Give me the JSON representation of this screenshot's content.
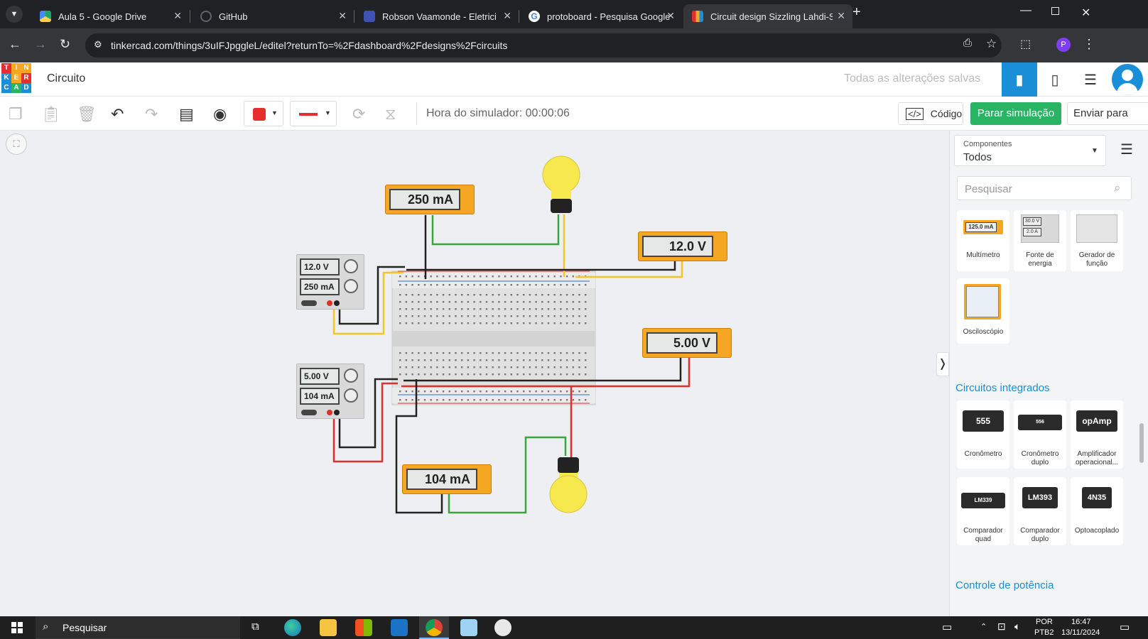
{
  "browser": {
    "tabs": [
      {
        "title": "Aula 5 - Google Drive",
        "icon": "google-drive-icon"
      },
      {
        "title": "GitHub",
        "icon": "github-icon"
      },
      {
        "title": "Robson Vaamonde - Eletricidad",
        "icon": "doc-icon"
      },
      {
        "title": "protoboard - Pesquisa Google",
        "icon": "google-icon"
      },
      {
        "title": "Circuit design Sizzling Lahdi-Sa",
        "icon": "tinkercad-icon"
      }
    ],
    "url": "tinkercad.com/things/3uIFJpggleL/editel?returnTo=%2Fdashboard%2Fdesigns%2Fcircuits",
    "profile_initial": "P"
  },
  "app": {
    "logo_letters": [
      "T",
      "I",
      "N",
      "K",
      "E",
      "R",
      "C",
      "A",
      "D"
    ],
    "title": "Circuito",
    "save_status": "Todas as alterações salvas"
  },
  "toolbar": {
    "simulator_time": "Hora do simulador: 00:00:06",
    "code_label": "Código",
    "stop_sim_label": "Parar simulação",
    "send_label": "Enviar para"
  },
  "colors": {
    "accent": "#1a8fd8",
    "stop_sim": "#28b463",
    "fill_color": "#e62e2e",
    "wire_red": "#e0302b",
    "wire_black": "#222222",
    "wire_green": "#3aa53a",
    "wire_yellow": "#f2c624",
    "bulb": "#f7e84e"
  },
  "circuit": {
    "psu1": {
      "voltage": "12.0 V",
      "current": "250 mA"
    },
    "psu2": {
      "voltage": "5.00 V",
      "current": "104 mA"
    },
    "meter_top_current": "250 mA",
    "meter_top_voltage": "12.0 V",
    "meter_mid_voltage": "5.00 V",
    "meter_bottom_current": "104 mA"
  },
  "panel": {
    "components_label": "Componentes",
    "components_value": "Todos",
    "search_placeholder": "Pesquisar",
    "instruments": [
      {
        "name": "Multímetro",
        "mini": "125.0 mA"
      },
      {
        "name": "Fonte de energia",
        "mini_v": "30.0 V",
        "mini_a": "2.0 A"
      },
      {
        "name": "Gerador de função"
      },
      {
        "name": "Osciloscópio"
      }
    ],
    "section_ic": "Circuitos integrados",
    "ics": [
      {
        "chip": "555",
        "name": "Cronômetro"
      },
      {
        "chip": "556",
        "name": "Cronômetro duplo"
      },
      {
        "chip": "opAmp",
        "name": "Amplificador operacional..."
      },
      {
        "chip": "LM339",
        "name": "Comparador quad"
      },
      {
        "chip": "LM393",
        "name": "Comparador duplo"
      },
      {
        "chip": "4N35",
        "name": "Optoacoplado"
      }
    ],
    "section_power": "Controle de potência"
  },
  "taskbar": {
    "search_label": "Pesquisar",
    "lang_line1": "POR",
    "lang_line2": "PTB2",
    "time": "16:47",
    "date": "13/11/2024"
  }
}
